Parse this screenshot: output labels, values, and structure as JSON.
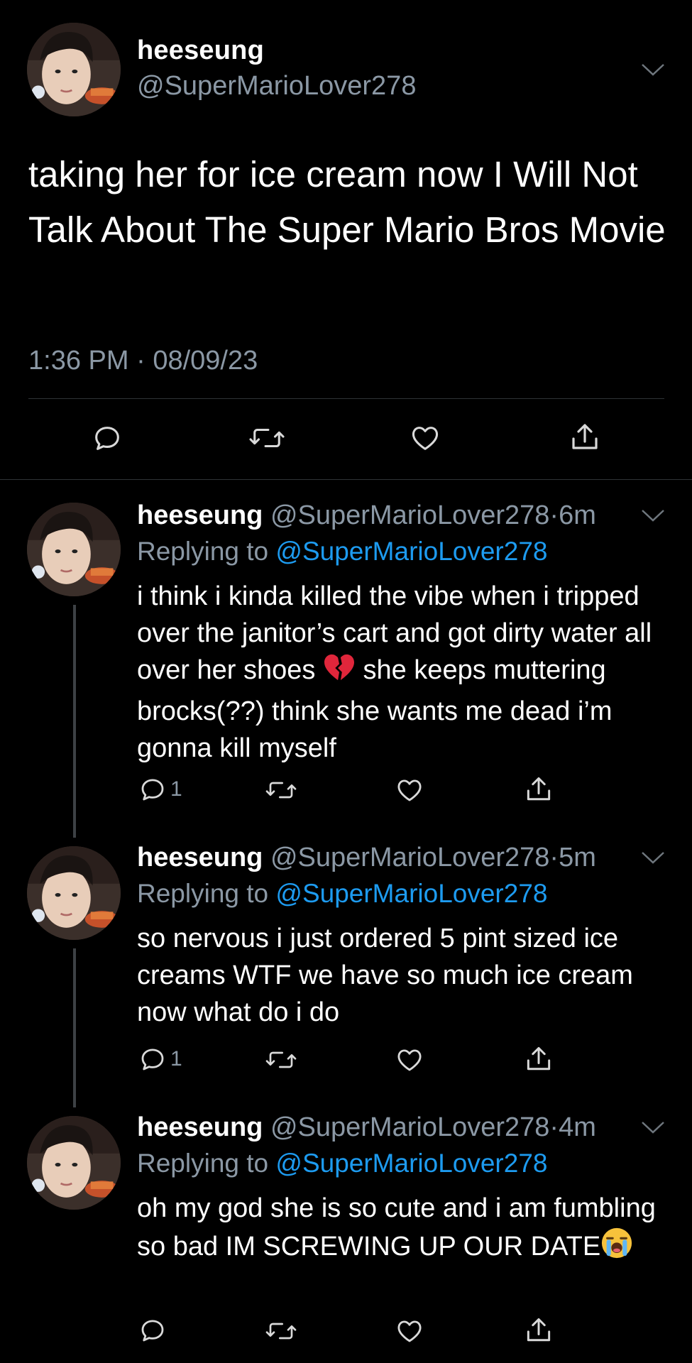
{
  "main_tweet": {
    "name": "heeseung",
    "handle": "@SuperMarioLover278",
    "text": "taking her for ice cream now I Will Not Talk About The Super Mario Bros Movie",
    "time": "1:36 PM",
    "separator": "·",
    "date": "08/09/23",
    "actions": {
      "reply_icon": "reply-icon",
      "retweet_icon": "retweet-icon",
      "like_icon": "heart-icon",
      "share_icon": "share-icon"
    }
  },
  "replies": [
    {
      "name": "heeseung",
      "handle": "@SuperMarioLover278",
      "separator": "·",
      "time": "6m",
      "replying_label": "Replying to",
      "replying_to": "@SuperMarioLover278",
      "text_before_emoji": "i think i kinda killed the vibe when i tripped over the janitor’s cart and got dirty water all over her shoes ",
      "emoji": "broken-heart",
      "text_after_emoji": " she keeps muttering brocks(??) think she wants me dead i’m gonna kill myself",
      "reply_count": "1"
    },
    {
      "name": "heeseung",
      "handle": "@SuperMarioLover278",
      "separator": "·",
      "time": "5m",
      "replying_label": "Replying to",
      "replying_to": "@SuperMarioLover278",
      "text": "so nervous i just ordered 5 pint sized ice creams WTF we have so much ice cream now what do i do",
      "reply_count": "1"
    },
    {
      "name": "heeseung",
      "handle": "@SuperMarioLover278",
      "separator": "·",
      "time": "4m",
      "replying_label": "Replying to",
      "replying_to": "@SuperMarioLover278",
      "text": "oh my god she is so cute and i am fumbling so bad IM SCREWING UP OUR DATE",
      "emoji": "loudly-crying-face",
      "reply_count": ""
    }
  ],
  "colors": {
    "background": "#000000",
    "text": "#ffffff",
    "secondary": "#8b98a5",
    "link": "#1d9bf0",
    "divider": "#2f3336"
  }
}
